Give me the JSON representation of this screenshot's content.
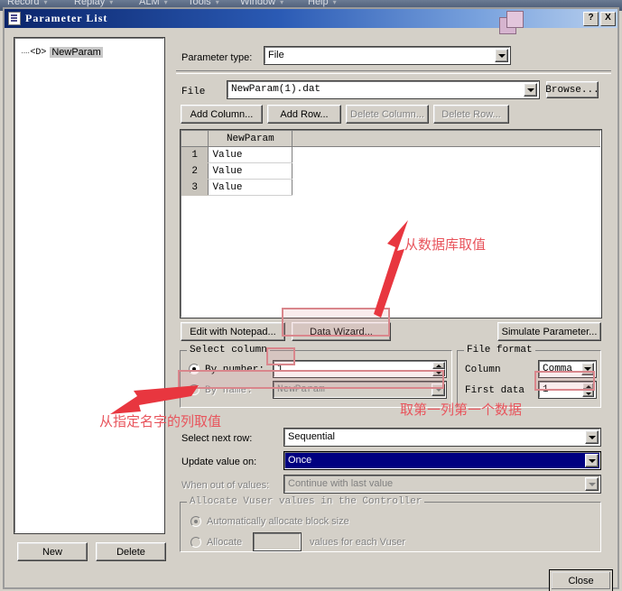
{
  "appbar": {
    "menus": [
      "Record",
      "Replay",
      "ALM",
      "Tools",
      "Window",
      "Help"
    ]
  },
  "dialog": {
    "title": "Parameter List",
    "help_button": "?",
    "close_button": "X"
  },
  "tree": {
    "items": [
      {
        "icon": "<D>",
        "label": "NewParam"
      }
    ]
  },
  "left_buttons": {
    "new": "New",
    "delete": "Delete"
  },
  "footer": {
    "close": "Close"
  },
  "parameter_type": {
    "label": "Parameter type:",
    "value": "File"
  },
  "file_row": {
    "label": "File",
    "value": "NewParam(1).dat",
    "browse": "Browse..."
  },
  "table_buttons": {
    "add_column": "Add Column...",
    "add_row": "Add Row...",
    "delete_column": "Delete Column...",
    "delete_row": "Delete Row..."
  },
  "grid": {
    "columns": [
      "NewParam"
    ],
    "rows": [
      {
        "num": "1",
        "values": [
          "Value"
        ]
      },
      {
        "num": "2",
        "values": [
          "Value"
        ]
      },
      {
        "num": "3",
        "values": [
          "Value"
        ]
      }
    ]
  },
  "action_buttons": {
    "edit_notepad": "Edit with Notepad...",
    "data_wizard": "Data Wizard...",
    "simulate": "Simulate Parameter..."
  },
  "select_column": {
    "legend": "Select column",
    "by_number_label": "By number:",
    "by_number_value": "1",
    "by_name_label": "By name:",
    "by_name_value": "NewParam",
    "selected": "by_number"
  },
  "file_format": {
    "legend": "File format",
    "column_label": "Column",
    "column_value": "Comma",
    "first_data_label": "First data",
    "first_data_value": "1"
  },
  "options": {
    "select_next_row_label": "Select next row:",
    "select_next_row_value": "Sequential",
    "update_value_on_label": "Update value on:",
    "update_value_on_value": "Once",
    "when_out_label": "When out of values:",
    "when_out_value": "Continue with last value"
  },
  "allocate": {
    "legend": "Allocate Vuser values in the Controller",
    "auto_label": "Automatically allocate block size",
    "allocate_label": "Allocate",
    "allocate_value": "",
    "allocate_suffix": "values for each Vuser"
  },
  "annotations": [
    {
      "text": "从数据库取值"
    },
    {
      "text": "从指定名字的列取值"
    },
    {
      "text": "取第一列第一个数据"
    }
  ],
  "colors": {
    "accent_red": "#e8545c",
    "highlight_box": "#d9868c",
    "title_blue": "#0a246a",
    "selection_blue": "#000080"
  }
}
